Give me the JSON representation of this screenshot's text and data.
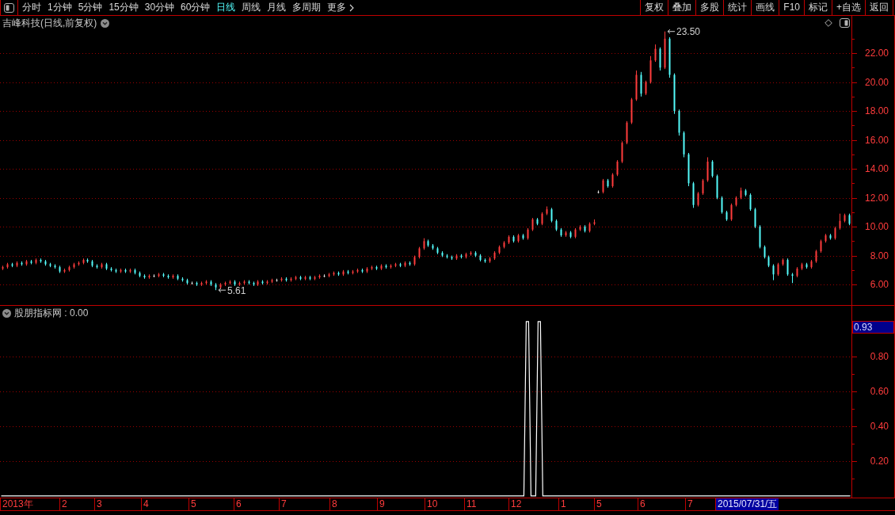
{
  "toolbar": {
    "periods": [
      {
        "label": "分时",
        "selected": false,
        "kind": "period"
      },
      {
        "label": "1分钟",
        "selected": false,
        "kind": "period"
      },
      {
        "label": "5分钟",
        "selected": false,
        "kind": "period"
      },
      {
        "label": "15分钟",
        "selected": false,
        "kind": "period"
      },
      {
        "label": "30分钟",
        "selected": false,
        "kind": "period"
      },
      {
        "label": "60分钟",
        "selected": false,
        "kind": "period"
      },
      {
        "label": "日线",
        "selected": true,
        "kind": "period"
      },
      {
        "label": "周线",
        "selected": false,
        "kind": "period"
      },
      {
        "label": "月线",
        "selected": false,
        "kind": "period"
      },
      {
        "label": "多周期",
        "selected": false,
        "kind": "period"
      },
      {
        "label": "更多",
        "selected": false,
        "kind": "menu"
      }
    ],
    "actions": [
      "复权",
      "叠加",
      "多股",
      "统计",
      "画线",
      "F10",
      "标记",
      "+自选",
      "返回"
    ]
  },
  "price_panel": {
    "title": "吉峰科技(日线,前复权)",
    "chart_data": {
      "type": "candlestick",
      "grid": true,
      "categories": [
        null,
        null,
        null,
        null,
        null,
        null,
        null,
        null,
        null,
        null,
        null,
        null,
        null,
        null,
        null,
        null,
        null,
        null,
        null,
        null,
        null,
        null,
        null,
        null,
        null,
        null,
        null,
        null,
        null,
        null,
        null,
        null,
        null,
        null,
        null,
        null,
        null,
        null,
        null,
        null,
        null,
        null,
        null,
        null,
        null,
        null,
        null,
        null,
        null,
        null,
        null,
        null,
        null,
        null,
        null,
        null,
        null,
        null,
        null,
        null,
        null,
        null,
        null,
        null,
        null,
        null,
        null,
        null,
        null,
        null,
        null,
        null,
        null,
        null,
        null,
        null,
        null,
        null,
        null,
        null,
        null,
        null,
        null,
        null,
        null,
        null,
        null,
        null,
        null,
        null,
        null,
        null,
        null,
        null,
        null,
        null,
        null,
        null,
        null,
        null,
        null,
        null,
        null,
        null,
        null,
        null,
        null,
        null,
        null,
        null,
        null,
        null,
        null,
        null,
        null,
        null,
        null,
        null,
        null,
        null,
        null,
        null,
        null,
        null,
        null,
        null,
        null,
        null,
        null,
        null,
        null,
        null,
        null,
        null,
        null,
        null,
        null,
        null,
        null,
        null,
        null,
        null,
        null,
        null,
        null,
        null,
        null,
        null,
        null,
        null,
        null,
        null,
        null,
        null,
        null,
        null,
        null,
        null,
        null,
        null,
        null,
        null,
        null,
        null,
        null,
        null,
        null,
        null,
        null,
        null,
        null,
        null,
        null,
        null,
        null,
        null,
        null,
        null,
        null,
        null
      ],
      "ylim": [
        4.58,
        24.58
      ],
      "yticks": [
        {
          "value": 22,
          "label": "22.00"
        },
        {
          "value": 20,
          "label": "20.00"
        },
        {
          "value": 18,
          "label": "18.00"
        },
        {
          "value": 16,
          "label": "16.00"
        },
        {
          "value": 14,
          "label": "14.00"
        },
        {
          "value": 12,
          "label": "12.00"
        },
        {
          "value": 10,
          "label": "10.00"
        },
        {
          "value": 8,
          "label": "8.00"
        },
        {
          "value": 6,
          "label": "6.00"
        }
      ],
      "annotations": [
        "23.50",
        "5.61"
      ]
    }
  },
  "indicator_panel": {
    "title": "股朋指标网 : 0.00",
    "value_tag": "0.93",
    "chart_data": {
      "type": "line",
      "grid": true,
      "categories": [
        null,
        null,
        null,
        null,
        null,
        null,
        null,
        null,
        null,
        null,
        null,
        null,
        null,
        null,
        null,
        null,
        null,
        null,
        null,
        null,
        null,
        null,
        null,
        null,
        null,
        null,
        null,
        null,
        null,
        null,
        null,
        null,
        null,
        null,
        null,
        null,
        null,
        null,
        null,
        null,
        null,
        null,
        null,
        null,
        null,
        null,
        null,
        null,
        null,
        null,
        null,
        null,
        null,
        null,
        null,
        null,
        null,
        null,
        null,
        null,
        null,
        null,
        null,
        null,
        null,
        null,
        null,
        null,
        null,
        null,
        null,
        null,
        null,
        null,
        null,
        null,
        null,
        null,
        null,
        null,
        null,
        null,
        null,
        null,
        null,
        null,
        null,
        null,
        null,
        null,
        null,
        null,
        null,
        null,
        null,
        null,
        null,
        null,
        null,
        null,
        null,
        null,
        null,
        null,
        null,
        null,
        null,
        null,
        null,
        null,
        null,
        null,
        null,
        null,
        null,
        null,
        null,
        null,
        null,
        null,
        null,
        null,
        null,
        null,
        null,
        null,
        null,
        null,
        null,
        null,
        null,
        null,
        null,
        null,
        null,
        null,
        null,
        null,
        null,
        null,
        null,
        null,
        null,
        null,
        null,
        null,
        null,
        null,
        null,
        null,
        null,
        null,
        null,
        null,
        null,
        null,
        null,
        null,
        null,
        null,
        null,
        null,
        null,
        null,
        null,
        null,
        null,
        null,
        null,
        null,
        null,
        null,
        null,
        null,
        null,
        null,
        null,
        null,
        null,
        null,
        null,
        null,
        null,
        null,
        null,
        null,
        null,
        null,
        null,
        null,
        null,
        null,
        null,
        null,
        null,
        null,
        null,
        null,
        null,
        null,
        null,
        null,
        null,
        null,
        null,
        null,
        null,
        null,
        null,
        null,
        null,
        null,
        null,
        null,
        null,
        null,
        null,
        null,
        null,
        null,
        null,
        null,
        null,
        null,
        null,
        null,
        null,
        null,
        null,
        null,
        null,
        null,
        null,
        null,
        null,
        null,
        null,
        null,
        null,
        null,
        null,
        null,
        null,
        null,
        null,
        null,
        null,
        null,
        null,
        null,
        null,
        null,
        null,
        null,
        null,
        null,
        null,
        null,
        null,
        null,
        null,
        null,
        null,
        null,
        null,
        null,
        null,
        null,
        null,
        null,
        null,
        null,
        null,
        null,
        null,
        null,
        null,
        null,
        null,
        null,
        null,
        null,
        null,
        null,
        null,
        null,
        null,
        null,
        null,
        null,
        null,
        null,
        null,
        null,
        null,
        null,
        null,
        null,
        null,
        null,
        null,
        null,
        null,
        null,
        null,
        null,
        null,
        null,
        null,
        null,
        null,
        null,
        null,
        null,
        null,
        null,
        null,
        null,
        null,
        null,
        null,
        null,
        null,
        null,
        null,
        null,
        null,
        null,
        null,
        null,
        null,
        null,
        null,
        null,
        null,
        null,
        null,
        null,
        null,
        null,
        null,
        null,
        null,
        null,
        null,
        null,
        null,
        null,
        null,
        null,
        null,
        null,
        null,
        null,
        null,
        null,
        null,
        null,
        null,
        null
      ],
      "values": [
        0,
        0,
        0,
        0,
        0,
        0,
        0,
        0,
        0,
        0,
        0,
        0,
        0,
        0,
        0,
        0,
        0,
        0,
        0,
        0,
        0,
        0,
        0,
        0,
        0,
        0,
        0,
        0,
        0,
        0,
        0,
        0,
        0,
        0,
        0,
        0,
        0,
        0,
        0,
        0,
        0,
        0,
        0,
        0,
        0,
        0,
        0,
        0,
        0,
        0,
        0,
        0,
        0,
        0,
        0,
        0,
        0,
        0,
        0,
        0,
        0,
        0,
        0,
        0,
        0,
        0,
        0,
        0,
        0,
        0,
        0,
        0,
        0,
        0,
        0,
        0,
        0,
        0,
        0,
        0,
        0,
        0,
        0,
        0,
        0,
        0,
        0,
        0,
        0,
        0,
        0,
        0,
        0,
        0,
        0,
        0,
        0,
        0,
        0,
        0,
        0,
        0,
        0,
        0,
        0,
        0,
        0,
        0,
        0,
        0,
        0,
        0,
        0,
        0,
        0,
        0,
        0,
        0,
        0,
        0,
        0,
        0,
        0,
        0,
        0,
        0,
        0,
        0,
        0,
        0,
        0,
        0,
        0,
        0,
        0,
        0,
        0,
        0,
        0,
        0,
        0,
        0,
        0,
        0,
        0,
        0,
        0,
        0,
        0,
        0,
        0,
        0,
        0,
        0,
        0,
        0,
        0,
        0,
        0,
        0,
        0,
        0,
        0,
        0,
        0,
        0,
        0,
        0,
        0,
        0,
        0,
        0,
        0,
        0,
        0,
        0,
        0,
        0,
        0,
        0,
        0,
        0,
        0,
        0,
        0,
        0,
        0,
        0,
        0,
        0,
        0,
        0,
        0,
        0,
        0,
        0,
        0,
        0,
        0,
        0,
        0,
        0,
        0,
        0,
        0,
        0,
        0,
        0,
        0,
        0,
        0,
        0,
        0,
        0,
        0,
        0,
        0,
        0,
        0,
        0,
        0,
        0,
        1,
        1,
        0,
        0,
        0,
        1,
        1,
        0,
        0,
        0,
        0,
        0,
        0,
        0,
        0,
        0,
        0,
        0,
        0,
        0,
        0,
        0,
        0,
        0,
        0,
        0,
        0,
        0,
        0,
        0,
        0,
        0,
        0,
        0,
        0,
        0,
        0,
        0,
        0,
        0,
        0,
        0,
        0,
        0,
        0,
        0,
        0,
        0,
        0,
        0,
        0,
        0,
        0,
        0,
        0,
        0,
        0,
        0,
        0,
        0,
        0,
        0,
        0,
        0,
        0,
        0,
        0,
        0,
        0,
        0,
        0,
        0,
        0,
        0,
        0,
        0,
        0,
        0,
        0,
        0,
        0,
        0,
        0,
        0,
        0,
        0,
        0,
        0,
        0,
        0,
        0,
        0,
        0,
        0,
        0,
        0,
        0,
        0,
        0,
        0,
        0,
        0,
        0,
        0,
        0,
        0,
        0,
        0,
        0,
        0,
        0,
        0,
        0,
        0,
        0,
        0,
        0,
        0,
        0,
        0,
        0,
        0,
        0,
        0,
        0,
        0,
        0,
        0,
        0,
        0,
        0,
        0,
        0,
        0,
        0,
        0,
        0,
        0
      ],
      "ylim": [
        -0.01,
        1.09
      ],
      "yticks": [
        {
          "value": 0.8,
          "label": "0.80"
        },
        {
          "value": 0.6,
          "label": "0.60"
        },
        {
          "value": 0.4,
          "label": "0.40"
        },
        {
          "value": 0.2,
          "label": "0.20"
        }
      ]
    }
  },
  "time_axis": {
    "labels": [
      "2013年",
      "2",
      "3",
      "4",
      "5",
      "6",
      "7",
      "8",
      "9",
      "10",
      "11",
      "12",
      "1",
      "5",
      "6",
      "7"
    ],
    "cursor_date": "2015/07/31/五"
  }
}
